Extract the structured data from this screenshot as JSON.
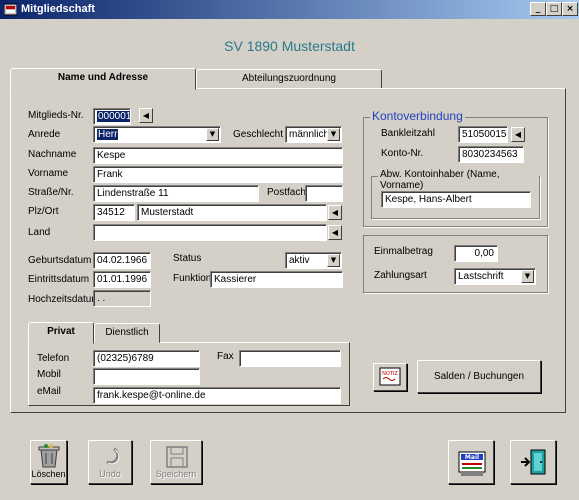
{
  "window": {
    "title": "Mitgliedschaft"
  },
  "header": {
    "title": "SV 1890 Musterstadt"
  },
  "tabs": {
    "main": [
      "Name und Adresse",
      "Abteilungszuordnung"
    ],
    "contact": [
      "Privat",
      "Dienstlich"
    ]
  },
  "member": {
    "nr_label": "Mitglieds-Nr.",
    "nr": "000001",
    "anrede_label": "Anrede",
    "anrede": "Herr",
    "geschlecht_label": "Geschlecht",
    "geschlecht": "männlich",
    "nachname_label": "Nachname",
    "nachname": "Kespe",
    "vorname_label": "Vorname",
    "vorname": "Frank",
    "strasse_label": "Straße/Nr.",
    "strasse": "Lindenstraße 11",
    "postfach_label": "Postfach",
    "postfach": "",
    "plzort_label": "Plz/Ort",
    "plz": "34512",
    "ort": "Musterstadt",
    "land_label": "Land",
    "land": ""
  },
  "dates": {
    "geburtsdatum_label": "Geburtsdatum",
    "geburtsdatum": "04.02.1966",
    "eintrittsdatum_label": "Eintrittsdatum",
    "eintrittsdatum": "01.01.1996",
    "hochzeitsdatum_label": "Hochzeitsdatum",
    "hochzeitsdatum": " . .",
    "status_label": "Status",
    "status": "aktiv",
    "funktion_label": "Funktion",
    "funktion": "Kassierer"
  },
  "contact": {
    "telefon_label": "Telefon",
    "telefon": "(02325)6789",
    "fax_label": "Fax",
    "fax": "",
    "mobil_label": "Mobil",
    "mobil": "",
    "email_label": "eMail",
    "email": "frank.kespe@t-online.de"
  },
  "bank": {
    "legend": "Kontoverbindung",
    "blz_label": "Bankleitzahl",
    "blz": "51050015",
    "konto_label": "Konto-Nr.",
    "konto": "8030234563",
    "inhaber_legend": "Abw. Kontoinhaber (Name, Vorname)",
    "inhaber": "Kespe, Hans-Albert"
  },
  "payment": {
    "einmal_label": "Einmalbetrag",
    "einmal": "0,00",
    "zahlungsart_label": "Zahlungsart",
    "zahlungsart": "Lastschrift"
  },
  "buttons": {
    "notiz_icon_text": "NOTIZ",
    "salden": "Salden / Buchungen",
    "loeschen": "Löschen",
    "undo": "Undo",
    "speichern": "Speichern",
    "mail_icon_text": "Mail"
  }
}
